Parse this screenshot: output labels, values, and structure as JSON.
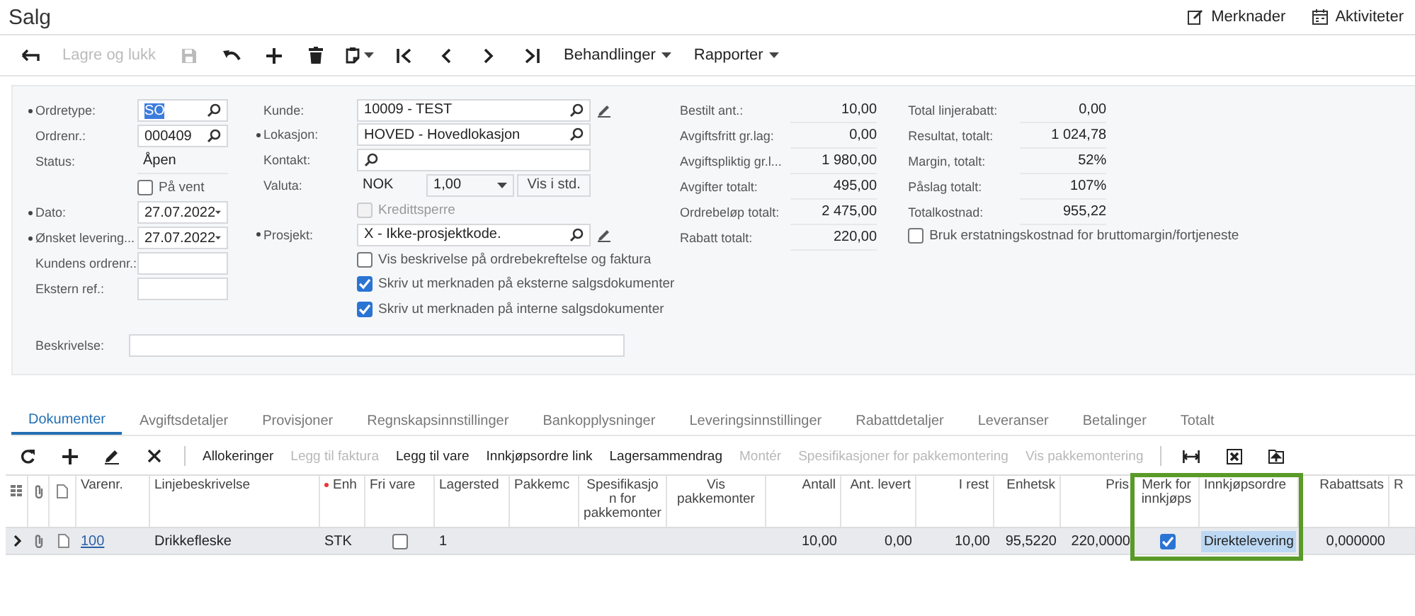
{
  "header": {
    "title": "Salg",
    "actions": [
      {
        "label": "Merknader"
      },
      {
        "label": "Aktiviteter"
      }
    ]
  },
  "toolbar": {
    "save_close": {
      "label": "Lagre og lukk",
      "disabled": true
    },
    "menus": [
      {
        "label": "Behandlinger"
      },
      {
        "label": "Rapporter"
      }
    ]
  },
  "form": {
    "left": [
      {
        "kind": "lookup",
        "label": "Ordretype:",
        "required": true,
        "value": "SO"
      },
      {
        "kind": "lookup",
        "label": "Ordrenr.:",
        "required": false,
        "value": "000409"
      },
      {
        "kind": "static",
        "label": "Status:",
        "required": false,
        "value": "Åpen"
      },
      {
        "kind": "checkbox",
        "label": "På vent",
        "checked": false,
        "disabled": false
      },
      {
        "kind": "date",
        "label": "Dato:",
        "required": true,
        "value": "27.07.2022"
      },
      {
        "kind": "date",
        "label": "Ønsket levering...",
        "required": true,
        "value": "27.07.2022"
      },
      {
        "kind": "input",
        "label": "Kundens ordrenr.:",
        "required": false
      },
      {
        "kind": "input",
        "label": "Ekstern ref.:",
        "required": false
      }
    ],
    "middle": [
      {
        "kind": "lookup",
        "label": "Kunde:",
        "required": false,
        "value": "10009 - TEST",
        "edit_button": true
      },
      {
        "kind": "lookup",
        "label": "Lokasjon:",
        "required": true,
        "value": "HOVED - Hovedlokasjon",
        "edit_button": false
      },
      {
        "kind": "lookup",
        "label": "Kontakt:",
        "required": false,
        "edit_button": false
      },
      {
        "kind": "currency",
        "label": "Valuta:",
        "required": false,
        "value": "NOK",
        "rate": "1,00",
        "button": "Vis i std."
      },
      {
        "kind": "checkbox",
        "label": "Kredittsperre",
        "checked": false,
        "disabled": true
      },
      {
        "kind": "lookup",
        "label": "Prosjekt:",
        "required": true,
        "value": "X - Ikke-prosjektkode.",
        "edit_button": true
      },
      {
        "kind": "checkbox",
        "label": "Vis beskrivelse på ordrebekreftelse og faktura",
        "checked": false,
        "disabled": false
      },
      {
        "kind": "checkbox",
        "label": "Skriv ut merknaden på eksterne salgsdokumenter",
        "checked": true,
        "disabled": false
      },
      {
        "kind": "checkbox",
        "label": "Skriv ut merknaden på interne salgsdokumenter",
        "checked": true,
        "disabled": false
      }
    ],
    "totals_1": [
      {
        "label": "Bestilt ant.:",
        "value": "10,00"
      },
      {
        "label": "Avgiftsfritt gr.lag:",
        "value": "0,00"
      },
      {
        "label": "Avgiftspliktig gr.l...",
        "value": "1 980,00"
      },
      {
        "label": "Avgifter totalt:",
        "value": "495,00"
      },
      {
        "label": "Ordrebeløp totalt:",
        "value": "2 475,00"
      },
      {
        "label": "Rabatt totalt:",
        "value": "220,00"
      }
    ],
    "totals_2": [
      {
        "label": "Total linjerabatt:",
        "value": "0,00"
      },
      {
        "label": "Resultat, totalt:",
        "value": "1 024,78"
      },
      {
        "label": "Margin, totalt:",
        "value": "52%"
      },
      {
        "label": "Påslag totalt:",
        "value": "107%"
      },
      {
        "label": "Totalkostnad:",
        "value": "955,22"
      }
    ],
    "replacement_cost": {
      "label": "Bruk erstatningskostnad for bruttomargin/fortjeneste",
      "checked": false
    },
    "description": {
      "label": "Beskrivelse:"
    }
  },
  "tabs": [
    {
      "label": "Dokumenter",
      "selected": true
    },
    {
      "label": "Avgiftsdetaljer",
      "selected": false
    },
    {
      "label": "Provisjoner",
      "selected": false
    },
    {
      "label": "Regnskapsinnstillinger",
      "selected": false
    },
    {
      "label": "Bankopplysninger",
      "selected": false
    },
    {
      "label": "Leveringsinnstillinger",
      "selected": false
    },
    {
      "label": "Rabattdetaljer",
      "selected": false
    },
    {
      "label": "Leveranser",
      "selected": false
    },
    {
      "label": "Betalinger",
      "selected": false
    },
    {
      "label": "Totalt",
      "selected": false
    }
  ],
  "grid_toolbar": [
    {
      "label": "Allokeringer",
      "disabled": false
    },
    {
      "label": "Legg til faktura",
      "disabled": true
    },
    {
      "label": "Legg til vare",
      "disabled": false
    },
    {
      "label": "Innkjøpsordre link",
      "disabled": false
    },
    {
      "label": "Lagersammendrag",
      "disabled": false
    },
    {
      "label": "Montér",
      "disabled": true
    },
    {
      "label": "Spesifikasjoner for pakkemontering",
      "disabled": true
    },
    {
      "label": "Vis pakkemontering",
      "disabled": true
    }
  ],
  "table": {
    "columns": [
      {
        "kind": "icon",
        "highlighted": false
      },
      {
        "kind": "icon",
        "highlighted": false
      },
      {
        "kind": "icon",
        "highlighted": false
      },
      {
        "kind": "link",
        "label": "Varenr.",
        "required": false,
        "highlighted": false
      },
      {
        "kind": "text",
        "label": "Linjebeskrivelse",
        "required": false,
        "highlighted": false
      },
      {
        "kind": "text",
        "label": "Enh",
        "required": true,
        "highlighted": false
      },
      {
        "kind": "check",
        "label": "Fri vare",
        "required": false,
        "highlighted": false
      },
      {
        "kind": "text",
        "label": "Lagersted",
        "required": false,
        "highlighted": false
      },
      {
        "kind": "text",
        "label": "Pakkemc",
        "required": false,
        "highlighted": false
      },
      {
        "kind": "text",
        "label": "Spesifikasjon for pakkemonter",
        "required": false,
        "highlighted": false
      },
      {
        "kind": "text",
        "label": "Vis pakkemonter",
        "required": false,
        "highlighted": false
      },
      {
        "kind": "number",
        "label": "Antall",
        "required": false,
        "highlighted": false
      },
      {
        "kind": "number",
        "label": "Ant. levert",
        "required": false,
        "highlighted": false
      },
      {
        "kind": "number",
        "label": "I rest",
        "required": false,
        "highlighted": false
      },
      {
        "kind": "number",
        "label": "Enhetsk",
        "required": false,
        "highlighted": false
      },
      {
        "kind": "number",
        "label": "Pris",
        "required": false,
        "highlighted": false
      },
      {
        "kind": "check",
        "label": "Merk for innkjøps",
        "required": false,
        "highlighted": true
      },
      {
        "kind": "text",
        "label": "Innkjøpsordre",
        "required": false,
        "highlighted": true
      },
      {
        "kind": "number",
        "label": "Rabattsats",
        "required": false,
        "highlighted": false
      },
      {
        "kind": "text",
        "label": "R",
        "required": false,
        "highlighted": false
      }
    ],
    "rows": [
      {
        "selected": true,
        "cells": [
          {},
          {},
          {},
          {
            "text": "100"
          },
          {
            "text": "Drikkefleske"
          },
          {
            "text": "STK"
          },
          {
            "checked": false
          },
          {
            "text": "1"
          },
          {},
          {},
          {},
          {
            "text": "10,00"
          },
          {
            "text": "0,00"
          },
          {
            "text": "10,00"
          },
          {
            "text": "95,5220"
          },
          {
            "text": "220,0000"
          },
          {
            "checked": true
          },
          {
            "text": "Direktelevering",
            "focused": true
          },
          {
            "text": "0,000000"
          },
          {}
        ]
      }
    ]
  }
}
